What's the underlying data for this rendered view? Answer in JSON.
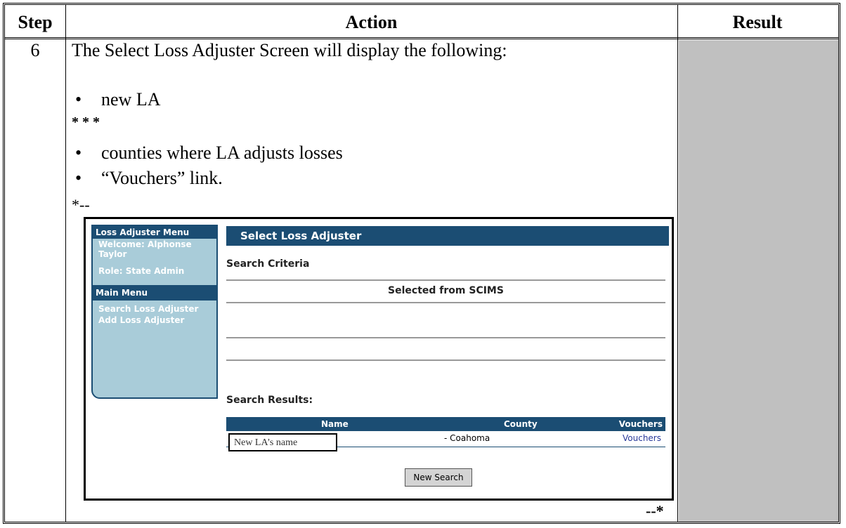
{
  "table": {
    "headers": {
      "step": "Step",
      "action": "Action",
      "result": "Result"
    },
    "row": {
      "step": "6",
      "intro": "The Select Loss Adjuster Screen will display the following:",
      "bullet1": "new LA",
      "stars": "* * *",
      "bullet2": "counties where LA adjusts losses",
      "bullet3": "“Vouchers” link.",
      "bullet_glyph": "•",
      "start_marker": "*--",
      "end_marker": "--*"
    }
  },
  "screenshot": {
    "sidebar": {
      "menu_title": "Loss Adjuster Menu",
      "welcome": "Welcome: Alphonse Taylor",
      "role": "Role: State Admin",
      "main_menu": "Main Menu",
      "items": [
        "Search Loss Adjuster",
        "Add Loss Adjuster"
      ]
    },
    "page_title": "Select Loss Adjuster",
    "search_criteria": "Search Criteria",
    "selected_from": "Selected from SCIMS",
    "search_results": "Search Results:",
    "results": {
      "columns": [
        "Name",
        "County",
        "Vouchers"
      ],
      "rows": [
        {
          "name": "New LA’s name",
          "county": "- Coahoma",
          "vouchers": "Vouchers"
        }
      ]
    },
    "new_search_button": "New Search"
  },
  "colors": {
    "header_blue": "#1b4d73",
    "sidebar_blue": "#a9ccd9",
    "result_gray": "#c0c0c0"
  }
}
